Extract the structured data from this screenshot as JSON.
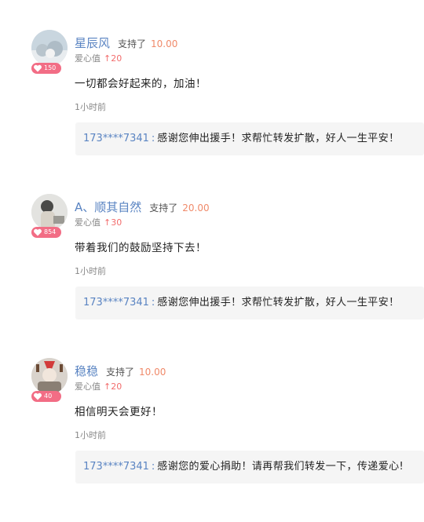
{
  "comments": [
    {
      "name": "星辰风",
      "support_label": "支持了",
      "amount": "10.00",
      "love_label": "爱心值",
      "love_arrow": "↑",
      "love_value": "20",
      "badge": "150",
      "text": "一切都会好起来的，加油！",
      "time": "1小时前",
      "reply": {
        "who": "173****7341",
        "colon": ":",
        "msg": "感谢您伸出援手！求帮忙转发扩散，好人一生平安！"
      }
    },
    {
      "name": "A、顺其自然",
      "support_label": "支持了",
      "amount": "20.00",
      "love_label": "爱心值",
      "love_arrow": "↑",
      "love_value": "30",
      "badge": "854",
      "text": "带着我们的鼓励坚持下去！",
      "time": "1小时前",
      "reply": {
        "who": "173****7341",
        "colon": ":",
        "msg": "感谢您伸出援手！求帮忙转发扩散，好人一生平安！"
      }
    },
    {
      "name": "稳稳",
      "support_label": "支持了",
      "amount": "10.00",
      "love_label": "爱心值",
      "love_arrow": "↑",
      "love_value": "20",
      "badge": "40",
      "text": "相信明天会更好！",
      "time": "1小时前",
      "reply": {
        "who": "173****7341",
        "colon": ":",
        "msg": "感谢您的爱心捐助！请再帮我们转发一下，传递爱心!"
      }
    }
  ],
  "colors": {
    "name": "#5a84c2",
    "amount": "#f08a6a",
    "badge": "#f26d85",
    "love": "#f26d6d"
  }
}
